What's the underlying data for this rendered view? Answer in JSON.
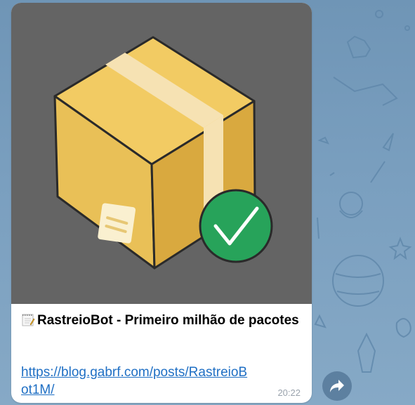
{
  "message": {
    "title": "RastreioBot - Primeiro milhão de pacotes",
    "link": "https://blog.gabrf.com/posts/RastreioBot1M/",
    "time": "20:22"
  },
  "icons": {
    "memo": "memo-icon",
    "package": "package-icon",
    "check": "checkmark-icon",
    "share": "share-arrow-icon"
  },
  "colors": {
    "media_background": "#646464",
    "box_front": "#e9c057",
    "box_side": "#d9a93f",
    "tape": "#f6e2b3",
    "check_circle": "#27a35a",
    "link": "#1f6fc4",
    "timestamp": "#9aa3ad"
  }
}
